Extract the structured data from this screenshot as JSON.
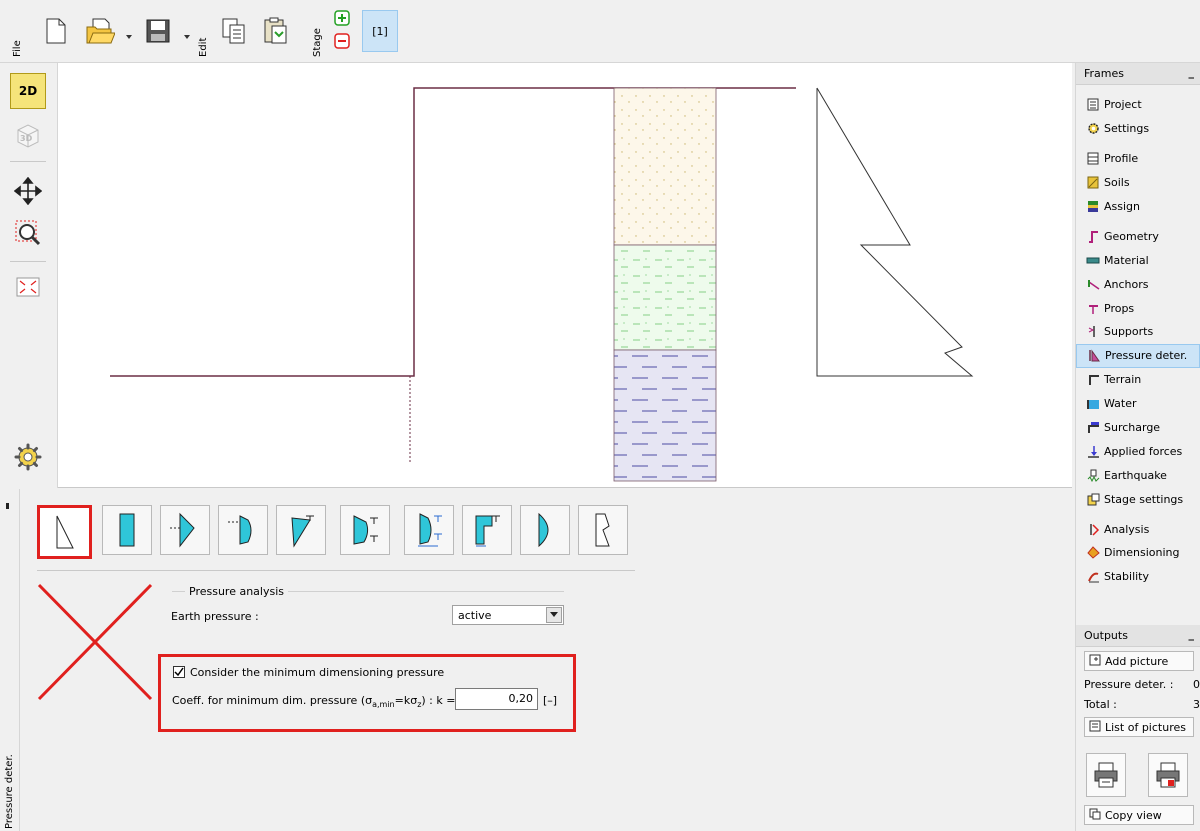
{
  "toolbar": {
    "file_label": "File",
    "edit_label": "Edit",
    "stage_label": "Stage",
    "stage_button_label": "[1]"
  },
  "left_tools": {
    "view_2d_label": "2D",
    "view_3d_label": "3D"
  },
  "frames": {
    "header": "Frames",
    "minimize": "_",
    "items": [
      {
        "label": "Project",
        "icon": "document-icon"
      },
      {
        "label": "Settings",
        "icon": "gear-icon"
      },
      {
        "label": "Profile",
        "icon": "profile-icon"
      },
      {
        "label": "Soils",
        "icon": "soils-icon"
      },
      {
        "label": "Assign",
        "icon": "assign-icon"
      },
      {
        "label": "Geometry",
        "icon": "geometry-icon"
      },
      {
        "label": "Material",
        "icon": "material-icon"
      },
      {
        "label": "Anchors",
        "icon": "anchors-icon"
      },
      {
        "label": "Props",
        "icon": "props-icon"
      },
      {
        "label": "Supports",
        "icon": "supports-icon"
      },
      {
        "label": "Pressure deter.",
        "icon": "pressure-icon",
        "selected": true
      },
      {
        "label": "Terrain",
        "icon": "terrain-icon"
      },
      {
        "label": "Water",
        "icon": "water-icon"
      },
      {
        "label": "Surcharge",
        "icon": "surcharge-icon"
      },
      {
        "label": "Applied forces",
        "icon": "forces-icon"
      },
      {
        "label": "Earthquake",
        "icon": "earthquake-icon"
      },
      {
        "label": "Stage settings",
        "icon": "stage-settings-icon"
      },
      {
        "label": "Analysis",
        "icon": "analysis-icon"
      },
      {
        "label": "Dimensioning",
        "icon": "dimensioning-icon"
      },
      {
        "label": "Stability",
        "icon": "stability-icon"
      }
    ]
  },
  "outputs": {
    "header": "Outputs",
    "minimize": "_",
    "add_picture": "Add picture",
    "pressure_deter_label": "Pressure deter. :",
    "pressure_deter_value": "0",
    "total_label": "Total :",
    "total_value": "3",
    "list_of_pictures": "List of pictures",
    "copy_view": "Copy view"
  },
  "bottom": {
    "side_label": "Pressure deter.",
    "section_title": "Pressure analysis",
    "earth_pressure_label": "Earth pressure :",
    "earth_pressure_value": "active",
    "min_pressure_checkbox_label": "Consider the minimum dimensioning pressure",
    "min_pressure_checked": true,
    "coeff_label_prefix": "Coeff. for minimum dim. pressure (σ",
    "coeff_label_sub1": "a,min",
    "coeff_label_mid": "=kσ",
    "coeff_label_sub2": "z",
    "coeff_label_suffix": ") :  k =",
    "coeff_value": "0,20",
    "coeff_unit": "[–]"
  },
  "colors": {
    "accent_selection": "#cce4f7",
    "highlight_red": "#e0201e",
    "wall_line": "#6b2f45",
    "soil1": "#fdf7ea",
    "soil2": "#eefbec",
    "soil3": "#e6e5f3"
  }
}
